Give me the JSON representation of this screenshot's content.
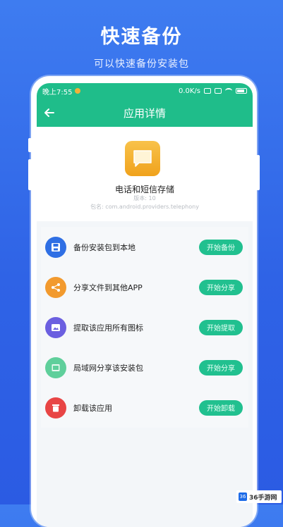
{
  "promo": {
    "title": "快速备份",
    "subtitle": "可以快速备份安装包"
  },
  "statusbar": {
    "time": "晚上7:55",
    "speed": "0.0K/s"
  },
  "appbar": {
    "title": "应用详情",
    "back_icon": "arrow-left-icon"
  },
  "app": {
    "icon": "message-bubble-icon",
    "name": "电话和短信存储",
    "version": "版本: 10",
    "package": "包名: com.android.providers.telephony"
  },
  "actions": [
    {
      "label": "备份安装包到本地",
      "button": "开始备份",
      "icon": "save-icon",
      "color": "#2f6fe4"
    },
    {
      "label": "分享文件到其他APP",
      "button": "开始分享",
      "icon": "share-icon",
      "color": "#f29a2e"
    },
    {
      "label": "提取该应用所有图标",
      "button": "开始提取",
      "icon": "image-icon",
      "color": "#6b5fe0"
    },
    {
      "label": "局域网分享该安装包",
      "button": "开始分享",
      "icon": "lan-icon",
      "color": "#5fcf9b"
    },
    {
      "label": "卸载该应用",
      "button": "开始卸载",
      "icon": "trash-icon",
      "color": "#e84545"
    }
  ],
  "colors": {
    "accent": "#1fbd8a",
    "button": "#21c08f",
    "background": "#2f63e6"
  },
  "watermark": {
    "logo": "36",
    "text": "36手游网"
  }
}
